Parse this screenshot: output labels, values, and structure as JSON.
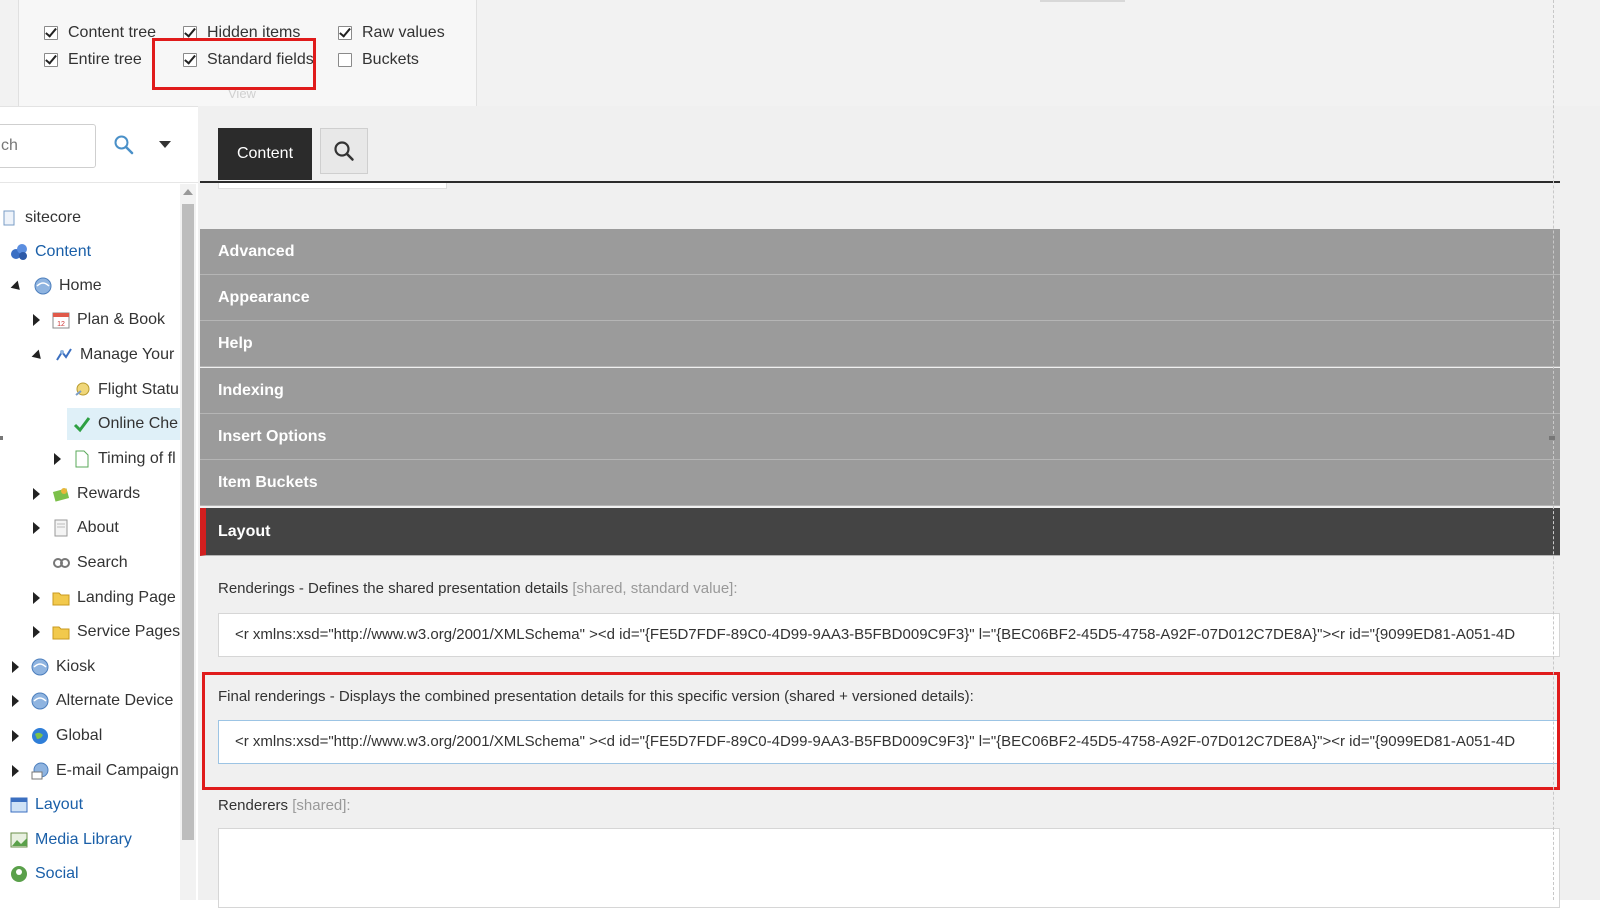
{
  "ribbon": {
    "options": [
      {
        "label": "Content tree",
        "checked": true
      },
      {
        "label": "Hidden items",
        "checked": true
      },
      {
        "label": "Raw values",
        "checked": true
      },
      {
        "label": "Entire tree",
        "checked": true
      },
      {
        "label": "Standard fields",
        "checked": true
      },
      {
        "label": "Buckets",
        "checked": false
      }
    ],
    "group_caption": "View"
  },
  "search": {
    "value": "ch"
  },
  "tree": {
    "nodes": [
      {
        "label": "sitecore",
        "icon": "sitecore-icon"
      },
      {
        "label": "Content",
        "icon": "content-icon"
      },
      {
        "label": "Home",
        "icon": "globe-icon"
      },
      {
        "label": "Plan & Book",
        "icon": "calendar-icon"
      },
      {
        "label": "Manage Your",
        "icon": "manage-icon"
      },
      {
        "label": "Flight Statu",
        "icon": "flight-icon"
      },
      {
        "label": "Online Che",
        "icon": "checkmark-icon"
      },
      {
        "label": "Timing of fl",
        "icon": "document-icon"
      },
      {
        "label": "Rewards",
        "icon": "rewards-icon"
      },
      {
        "label": "About",
        "icon": "page-icon"
      },
      {
        "label": "Search",
        "icon": "search-item-icon"
      },
      {
        "label": "Landing Page",
        "icon": "folder-icon"
      },
      {
        "label": "Service Pages",
        "icon": "folder-icon"
      },
      {
        "label": "Kiosk",
        "icon": "globe-icon"
      },
      {
        "label": "Alternate Device",
        "icon": "globe-icon"
      },
      {
        "label": "Global",
        "icon": "sphere-icon"
      },
      {
        "label": "E-mail Campaign",
        "icon": "email-globe-icon"
      },
      {
        "label": "Layout",
        "icon": "layout-icon"
      },
      {
        "label": "Media Library",
        "icon": "media-icon"
      },
      {
        "label": "Social",
        "icon": "social-icon"
      }
    ]
  },
  "editor": {
    "tab_content": "Content",
    "sections": [
      "Advanced",
      "Appearance",
      "Help",
      "Indexing",
      "Insert Options",
      "Item Buckets",
      "Layout"
    ],
    "active_section": "Layout",
    "fields": {
      "renderings_label": "Renderings - Defines the shared presentation details",
      "renderings_meta": "[shared, standard value]:",
      "renderings_value": "<r xmlns:xsd=\"http://www.w3.org/2001/XMLSchema\" ><d id=\"{FE5D7FDF-89C0-4D99-9AA3-B5FBD009C9F3}\" l=\"{BEC06BF2-45D5-4758-A92F-07D012C7DE8A}\"><r id=\"{9099ED81-A051-4D",
      "final_label": "Final renderings - Displays the combined presentation details for this specific version (shared + versioned details):",
      "final_value": "<r xmlns:xsd=\"http://www.w3.org/2001/XMLSchema\" ><d id=\"{FE5D7FDF-89C0-4D99-9AA3-B5FBD009C9F3}\" l=\"{BEC06BF2-45D5-4758-A92F-07D012C7DE8A}\"><r id=\"{9099ED81-A051-4D",
      "renderers_label": "Renderers",
      "renderers_meta": "[shared]:"
    }
  },
  "colors": {
    "accent_red": "#e01b1b",
    "section_gray": "#9b9b9b",
    "section_active": "#444444"
  }
}
